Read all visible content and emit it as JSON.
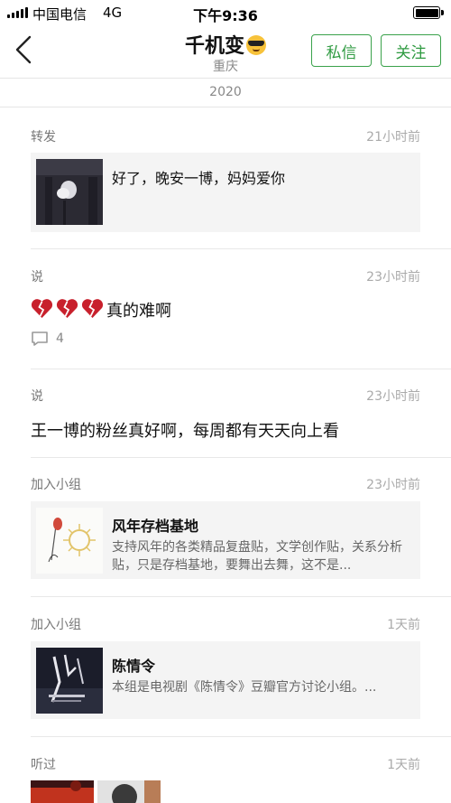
{
  "status_bar": {
    "carrier": "中国电信",
    "network": "4G",
    "time": "下午9:36"
  },
  "nav": {
    "title": "千机变",
    "location": "重庆",
    "message_button": "私信",
    "follow_button": "关注"
  },
  "year": "2020",
  "colors": {
    "accent": "#3aa24b",
    "card_bg": "#f4f4f4",
    "muted": "#777777"
  },
  "feed": [
    {
      "action": "转发",
      "time": "21小时前",
      "text": "好了，晚安一博，妈妈爱你"
    },
    {
      "action": "说",
      "time": "23小时前",
      "text": "真的难啊",
      "comments": "4"
    },
    {
      "action": "说",
      "time": "23小时前",
      "text": "王一博的粉丝真好啊，每周都有天天向上看"
    },
    {
      "action": "加入小组",
      "time": "23小时前",
      "title": "风年存档基地",
      "desc": "支持风年的各类精品复盘贴，文学创作贴，关系分析贴，只是存档基地，要舞出去舞，这不是..."
    },
    {
      "action": "加入小组",
      "time": "1天前",
      "title": "陈情令",
      "desc": "本组是电视剧《陈情令》豆瓣官方讨论小组。..."
    },
    {
      "action": "听过",
      "time": "1天前"
    }
  ]
}
